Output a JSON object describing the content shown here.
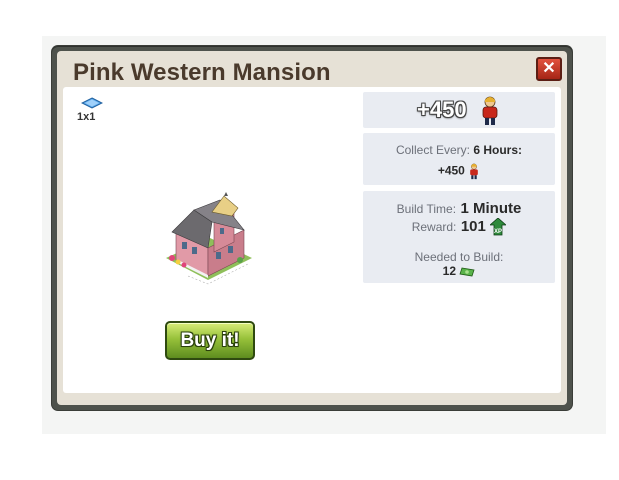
{
  "dialog": {
    "title": "Pink Western Mansion",
    "close_icon": "close-icon"
  },
  "item": {
    "tile_icon": "tile-footprint-icon",
    "tile_size": "1x1",
    "image_icon": "mansion-building-icon",
    "buy_label": "Buy it!"
  },
  "bonus": {
    "amount": "+450",
    "icon": "resident-person-icon"
  },
  "collect": {
    "label": "Collect Every:",
    "interval": "6 Hours:",
    "amount": "+450",
    "icon": "resident-person-icon"
  },
  "build": {
    "time_label": "Build Time:",
    "time_value": "1 Minute",
    "reward_label": "Reward:",
    "reward_value": "101",
    "reward_icon": "xp-icon",
    "needed_label": "Needed to Build:",
    "needed_value": "12",
    "needed_icon": "cash-icon"
  },
  "colors": {
    "frame": "#4e524c",
    "title_text": "#4a3a2c",
    "panel_bg": "#e9ecf2",
    "buy_green": "#97c13a",
    "close_red": "#c63a28"
  }
}
